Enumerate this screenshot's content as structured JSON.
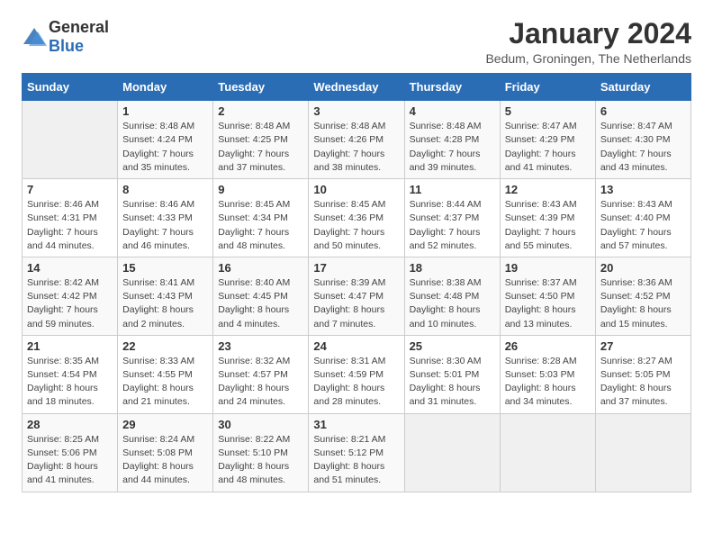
{
  "logo": {
    "general": "General",
    "blue": "Blue"
  },
  "header": {
    "month": "January 2024",
    "location": "Bedum, Groningen, The Netherlands"
  },
  "weekdays": [
    "Sunday",
    "Monday",
    "Tuesday",
    "Wednesday",
    "Thursday",
    "Friday",
    "Saturday"
  ],
  "weeks": [
    [
      {
        "day": "",
        "empty": true
      },
      {
        "day": "1",
        "sunrise": "Sunrise: 8:48 AM",
        "sunset": "Sunset: 4:24 PM",
        "daylight": "Daylight: 7 hours and 35 minutes."
      },
      {
        "day": "2",
        "sunrise": "Sunrise: 8:48 AM",
        "sunset": "Sunset: 4:25 PM",
        "daylight": "Daylight: 7 hours and 37 minutes."
      },
      {
        "day": "3",
        "sunrise": "Sunrise: 8:48 AM",
        "sunset": "Sunset: 4:26 PM",
        "daylight": "Daylight: 7 hours and 38 minutes."
      },
      {
        "day": "4",
        "sunrise": "Sunrise: 8:48 AM",
        "sunset": "Sunset: 4:28 PM",
        "daylight": "Daylight: 7 hours and 39 minutes."
      },
      {
        "day": "5",
        "sunrise": "Sunrise: 8:47 AM",
        "sunset": "Sunset: 4:29 PM",
        "daylight": "Daylight: 7 hours and 41 minutes."
      },
      {
        "day": "6",
        "sunrise": "Sunrise: 8:47 AM",
        "sunset": "Sunset: 4:30 PM",
        "daylight": "Daylight: 7 hours and 43 minutes."
      }
    ],
    [
      {
        "day": "7",
        "sunrise": "Sunrise: 8:46 AM",
        "sunset": "Sunset: 4:31 PM",
        "daylight": "Daylight: 7 hours and 44 minutes."
      },
      {
        "day": "8",
        "sunrise": "Sunrise: 8:46 AM",
        "sunset": "Sunset: 4:33 PM",
        "daylight": "Daylight: 7 hours and 46 minutes."
      },
      {
        "day": "9",
        "sunrise": "Sunrise: 8:45 AM",
        "sunset": "Sunset: 4:34 PM",
        "daylight": "Daylight: 7 hours and 48 minutes."
      },
      {
        "day": "10",
        "sunrise": "Sunrise: 8:45 AM",
        "sunset": "Sunset: 4:36 PM",
        "daylight": "Daylight: 7 hours and 50 minutes."
      },
      {
        "day": "11",
        "sunrise": "Sunrise: 8:44 AM",
        "sunset": "Sunset: 4:37 PM",
        "daylight": "Daylight: 7 hours and 52 minutes."
      },
      {
        "day": "12",
        "sunrise": "Sunrise: 8:43 AM",
        "sunset": "Sunset: 4:39 PM",
        "daylight": "Daylight: 7 hours and 55 minutes."
      },
      {
        "day": "13",
        "sunrise": "Sunrise: 8:43 AM",
        "sunset": "Sunset: 4:40 PM",
        "daylight": "Daylight: 7 hours and 57 minutes."
      }
    ],
    [
      {
        "day": "14",
        "sunrise": "Sunrise: 8:42 AM",
        "sunset": "Sunset: 4:42 PM",
        "daylight": "Daylight: 7 hours and 59 minutes."
      },
      {
        "day": "15",
        "sunrise": "Sunrise: 8:41 AM",
        "sunset": "Sunset: 4:43 PM",
        "daylight": "Daylight: 8 hours and 2 minutes."
      },
      {
        "day": "16",
        "sunrise": "Sunrise: 8:40 AM",
        "sunset": "Sunset: 4:45 PM",
        "daylight": "Daylight: 8 hours and 4 minutes."
      },
      {
        "day": "17",
        "sunrise": "Sunrise: 8:39 AM",
        "sunset": "Sunset: 4:47 PM",
        "daylight": "Daylight: 8 hours and 7 minutes."
      },
      {
        "day": "18",
        "sunrise": "Sunrise: 8:38 AM",
        "sunset": "Sunset: 4:48 PM",
        "daylight": "Daylight: 8 hours and 10 minutes."
      },
      {
        "day": "19",
        "sunrise": "Sunrise: 8:37 AM",
        "sunset": "Sunset: 4:50 PM",
        "daylight": "Daylight: 8 hours and 13 minutes."
      },
      {
        "day": "20",
        "sunrise": "Sunrise: 8:36 AM",
        "sunset": "Sunset: 4:52 PM",
        "daylight": "Daylight: 8 hours and 15 minutes."
      }
    ],
    [
      {
        "day": "21",
        "sunrise": "Sunrise: 8:35 AM",
        "sunset": "Sunset: 4:54 PM",
        "daylight": "Daylight: 8 hours and 18 minutes."
      },
      {
        "day": "22",
        "sunrise": "Sunrise: 8:33 AM",
        "sunset": "Sunset: 4:55 PM",
        "daylight": "Daylight: 8 hours and 21 minutes."
      },
      {
        "day": "23",
        "sunrise": "Sunrise: 8:32 AM",
        "sunset": "Sunset: 4:57 PM",
        "daylight": "Daylight: 8 hours and 24 minutes."
      },
      {
        "day": "24",
        "sunrise": "Sunrise: 8:31 AM",
        "sunset": "Sunset: 4:59 PM",
        "daylight": "Daylight: 8 hours and 28 minutes."
      },
      {
        "day": "25",
        "sunrise": "Sunrise: 8:30 AM",
        "sunset": "Sunset: 5:01 PM",
        "daylight": "Daylight: 8 hours and 31 minutes."
      },
      {
        "day": "26",
        "sunrise": "Sunrise: 8:28 AM",
        "sunset": "Sunset: 5:03 PM",
        "daylight": "Daylight: 8 hours and 34 minutes."
      },
      {
        "day": "27",
        "sunrise": "Sunrise: 8:27 AM",
        "sunset": "Sunset: 5:05 PM",
        "daylight": "Daylight: 8 hours and 37 minutes."
      }
    ],
    [
      {
        "day": "28",
        "sunrise": "Sunrise: 8:25 AM",
        "sunset": "Sunset: 5:06 PM",
        "daylight": "Daylight: 8 hours and 41 minutes."
      },
      {
        "day": "29",
        "sunrise": "Sunrise: 8:24 AM",
        "sunset": "Sunset: 5:08 PM",
        "daylight": "Daylight: 8 hours and 44 minutes."
      },
      {
        "day": "30",
        "sunrise": "Sunrise: 8:22 AM",
        "sunset": "Sunset: 5:10 PM",
        "daylight": "Daylight: 8 hours and 48 minutes."
      },
      {
        "day": "31",
        "sunrise": "Sunrise: 8:21 AM",
        "sunset": "Sunset: 5:12 PM",
        "daylight": "Daylight: 8 hours and 51 minutes."
      },
      {
        "day": "",
        "empty": true
      },
      {
        "day": "",
        "empty": true
      },
      {
        "day": "",
        "empty": true
      }
    ]
  ]
}
